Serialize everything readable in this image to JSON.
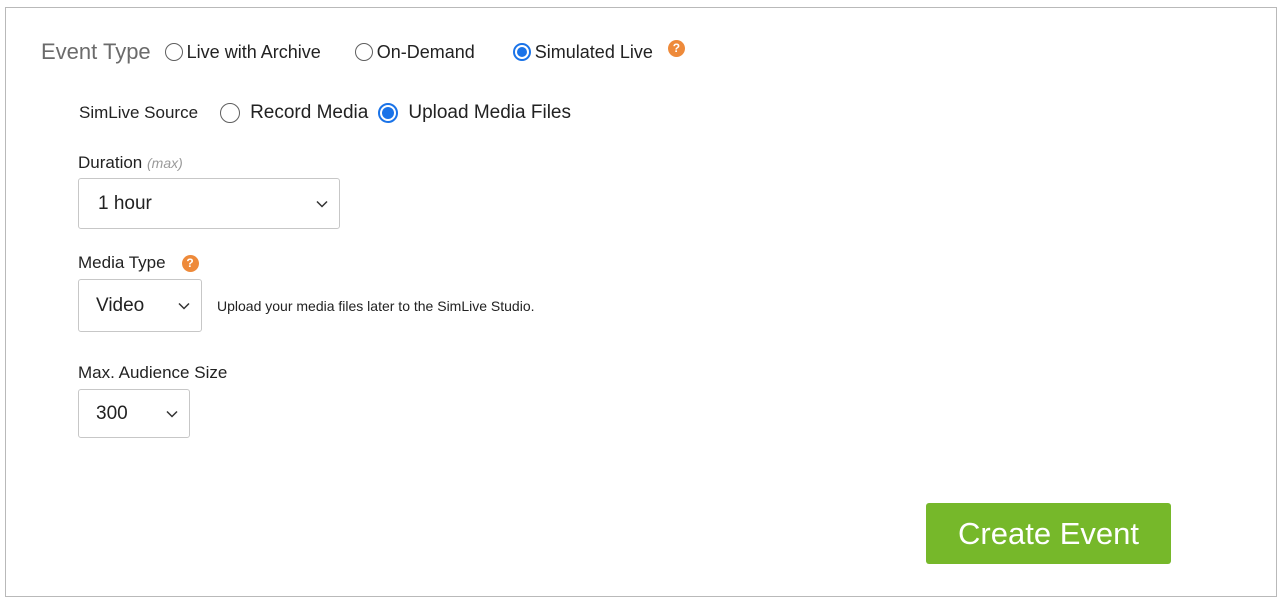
{
  "event_type": {
    "label": "Event Type",
    "options": [
      {
        "label": "Live with Archive",
        "selected": false
      },
      {
        "label": "On-Demand",
        "selected": false
      },
      {
        "label": "Simulated Live",
        "selected": true
      }
    ],
    "help_glyph": "?"
  },
  "simlive_source": {
    "label": "SimLive Source",
    "options": [
      {
        "label": "Record Media",
        "selected": false
      },
      {
        "label": "Upload Media Files",
        "selected": true
      }
    ]
  },
  "duration": {
    "label": "Duration",
    "hint": "(max)",
    "value": "1 hour"
  },
  "media_type": {
    "label": "Media Type",
    "value": "Video",
    "note": "Upload your media files later to the SimLive Studio.",
    "help_glyph": "?"
  },
  "audience": {
    "label": "Max. Audience Size",
    "value": "300"
  },
  "create_button": {
    "label": "Create Event"
  },
  "colors": {
    "accent_radio": "#1a73e8",
    "help_icon": "#ee8a3a",
    "create_button": "#76b82a"
  },
  "icons": {
    "help": "question-circle-icon",
    "dropdown": "chevron-down-icon"
  }
}
